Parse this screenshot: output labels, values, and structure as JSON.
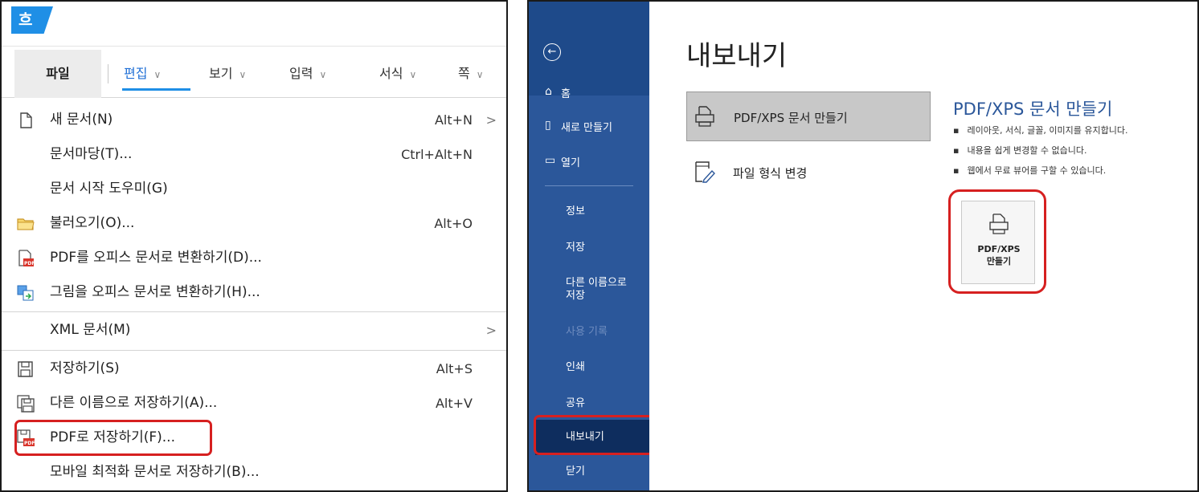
{
  "hancom": {
    "logo": "흐",
    "tabs": [
      {
        "label": "파일"
      },
      {
        "label": "편집"
      },
      {
        "label": "보기"
      },
      {
        "label": "입력"
      },
      {
        "label": "서식"
      },
      {
        "label": "쪽"
      }
    ],
    "menu": [
      {
        "label": "새 문서(N)",
        "shortcut": "Alt+N",
        "submenu": true,
        "icon": "new-doc-icon"
      },
      {
        "label": "문서마당(T)...",
        "shortcut": "Ctrl+Alt+N"
      },
      {
        "label": "문서 시작 도우미(G)"
      },
      {
        "label": "불러오기(O)...",
        "shortcut": "Alt+O",
        "icon": "folder-icon"
      },
      {
        "label": "PDF를 오피스 문서로 변환하기(D)...",
        "icon": "pdf-convert-icon"
      },
      {
        "label": "그림을 오피스 문서로 변환하기(H)...",
        "icon": "image-convert-icon"
      },
      {
        "label": "XML 문서(M)",
        "submenu": true
      },
      {
        "label": "저장하기(S)",
        "shortcut": "Alt+S",
        "icon": "save-icon"
      },
      {
        "label": "다른 이름으로 저장하기(A)...",
        "shortcut": "Alt+V",
        "icon": "save-as-icon"
      },
      {
        "label": "PDF로 저장하기(F)...",
        "icon": "pdf-save-icon"
      },
      {
        "label": "모바일 최적화 문서로 저장하기(B)..."
      }
    ]
  },
  "word": {
    "sidebar": {
      "home": "홈",
      "new": "새로 만들기",
      "open": "열기",
      "info": "정보",
      "save": "저장",
      "save_as_line1": "다른 이름으로",
      "save_as_line2": "저장",
      "history": "사용 기록",
      "print": "인쇄",
      "share": "공유",
      "export": "내보내기",
      "close": "닫기"
    },
    "title": "내보내기",
    "options": [
      {
        "label": "PDF/XPS 문서 만들기"
      },
      {
        "label": "파일 형식 변경"
      }
    ],
    "section_title": "PDF/XPS 문서 만들기",
    "bullets": [
      "레이아웃, 서식, 글꼴, 이미지를 유지합니다.",
      "내용을 쉽게 변경할 수 없습니다.",
      "웹에서 무료 뷰어를 구할 수 있습니다."
    ],
    "create_button": {
      "line1": "PDF/XPS",
      "line2": "만들기"
    }
  },
  "colors": {
    "hancom_blue": "#1f8fe6",
    "word_blue": "#2b579a",
    "highlight_red": "#d62020"
  }
}
